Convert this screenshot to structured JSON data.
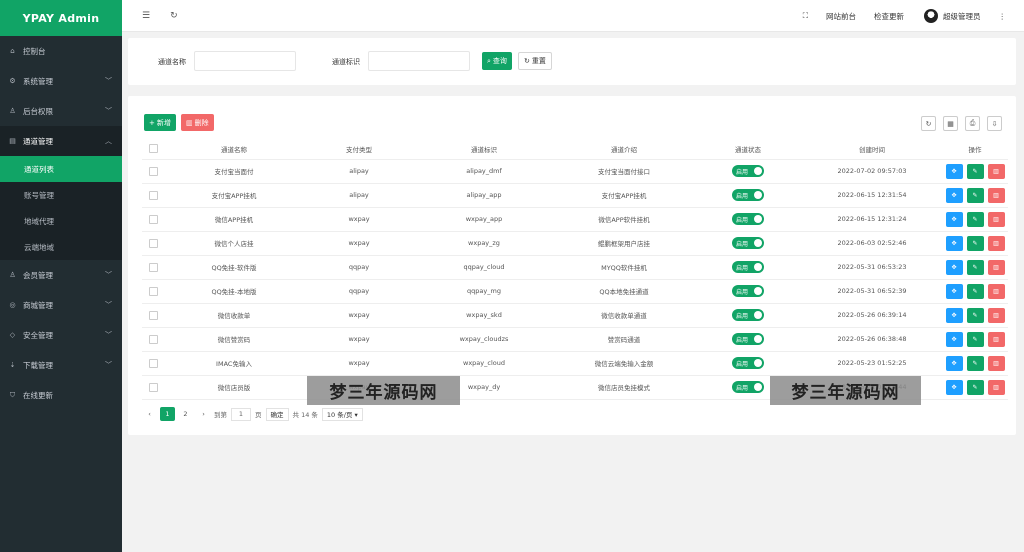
{
  "app": {
    "title": "YPAY Admin"
  },
  "sidebar": {
    "items": [
      {
        "label": "控制台",
        "icon": "home-icon",
        "chev": ""
      },
      {
        "label": "系统管理",
        "icon": "gear-icon",
        "chev": "﹀"
      },
      {
        "label": "后台权限",
        "icon": "user-icon",
        "chev": "﹀"
      },
      {
        "label": "通道管理",
        "icon": "channel-icon",
        "chev": "︿"
      },
      {
        "label": "会员管理",
        "icon": "user-icon",
        "chev": "﹀"
      },
      {
        "label": "商城管理",
        "icon": "shop-icon",
        "chev": "﹀"
      },
      {
        "label": "安全管理",
        "icon": "diamond-icon",
        "chev": "﹀"
      },
      {
        "label": "下载管理",
        "icon": "download-icon",
        "chev": "﹀"
      },
      {
        "label": "在线更新",
        "icon": "shield-icon",
        "chev": ""
      }
    ],
    "sub": [
      "通道列表",
      "账号管理",
      "地域代理",
      "云端地域"
    ]
  },
  "header": {
    "menu_icon": "☰",
    "refresh_icon": "↻",
    "fullscreen_icon": "⛶",
    "front": "网站前台",
    "update": "检查更新",
    "user": "超级管理员",
    "more_icon": "⋮"
  },
  "search": {
    "name_label": "通道名称",
    "id_label": "通道标识",
    "query": "查询",
    "reset": "重置"
  },
  "toolbar": {
    "add": "新增",
    "delete": "删除"
  },
  "table": {
    "headers": [
      "",
      "通道名称",
      "支付类型",
      "通道标识",
      "通道介绍",
      "通道状态",
      "创建时间",
      "操作"
    ],
    "status_label": "启用",
    "rows": [
      [
        "支付宝当面付",
        "alipay",
        "alipay_dmf",
        "支付宝当面付接口",
        "2022-07-02 09:57:03"
      ],
      [
        "支付宝APP挂机",
        "alipay",
        "alipay_app",
        "支付宝APP挂机",
        "2022-06-15 12:31:54"
      ],
      [
        "微信APP挂机",
        "wxpay",
        "wxpay_app",
        "微信APP软件挂机",
        "2022-06-15 12:31:24"
      ],
      [
        "微信个人店挂",
        "wxpay",
        "wxpay_zg",
        "鲲鹏框架用户店挂",
        "2022-06-03 02:52:46"
      ],
      [
        "QQ免挂-软件版",
        "qqpay",
        "qqpay_cloud",
        "MYQQ软件挂机",
        "2022-05-31 06:53:23"
      ],
      [
        "QQ免挂-本地版",
        "qqpay",
        "qqpay_mg",
        "QQ本地免挂通道",
        "2022-05-31 06:52:39"
      ],
      [
        "微信收款单",
        "wxpay",
        "wxpay_skd",
        "微信收款单通道",
        "2022-05-26 06:39:14"
      ],
      [
        "微信赞赏码",
        "wxpay",
        "wxpay_cloudzs",
        "赞赏码通道",
        "2022-05-26 06:38:48"
      ],
      [
        "IMAC免输入",
        "wxpay",
        "wxpay_cloud",
        "微信云端免输入金额",
        "2022-05-23 01:52:25"
      ],
      [
        "微信店员版",
        "wxpay",
        "wxpay_dy",
        "微信店员免挂模式",
        "2022-05-22 03:18:44"
      ]
    ]
  },
  "pager": {
    "prev": "‹",
    "pages": [
      "1",
      "2"
    ],
    "next": "›",
    "goto": "到第",
    "page_value": "1",
    "page_unit": "页",
    "confirm": "确定",
    "total": "共 14 条",
    "size": "10 条/页 ▾"
  },
  "watermark": "梦三年源码网",
  "colors": {
    "accent": "#11a466",
    "danger": "#f26868",
    "info": "#1e9fff",
    "sidebar": "#222d32"
  }
}
